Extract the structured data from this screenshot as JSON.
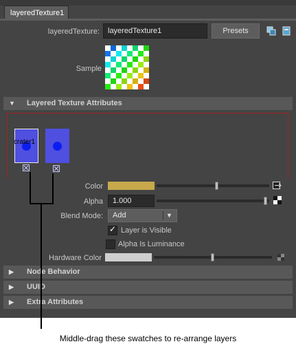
{
  "tab": {
    "label": "layeredTexture1"
  },
  "node": {
    "label": "layeredTexture:",
    "value": "layeredTexture1",
    "presets_label": "Presets"
  },
  "sample": {
    "label": "Sample"
  },
  "sections": {
    "layered": "Layered Texture Attributes",
    "node_behavior": "Node Behavior",
    "uuid": "UUID",
    "extra": "Extra Attributes"
  },
  "layers": [
    {
      "name": "crater1"
    },
    {
      "name": ""
    }
  ],
  "attrs": {
    "color_label": "Color",
    "color_value": "#c7a84b",
    "alpha_label": "Alpha",
    "alpha_value": "1.000",
    "blend_label": "Blend Mode:",
    "blend_value": "Add",
    "layer_visible_label": "Layer is Visible",
    "layer_visible_checked": true,
    "alpha_lum_label": "Alpha Is Luminance",
    "alpha_lum_checked": false,
    "hw_color_label": "Hardware Color"
  },
  "annotation": {
    "text": "Middle-drag these swatches to re-arrange layers"
  },
  "colors": {
    "panel": "#444444",
    "swatch": "#4f4fe0",
    "dot": "#0a1ef0",
    "red_frame": "#a52222"
  }
}
